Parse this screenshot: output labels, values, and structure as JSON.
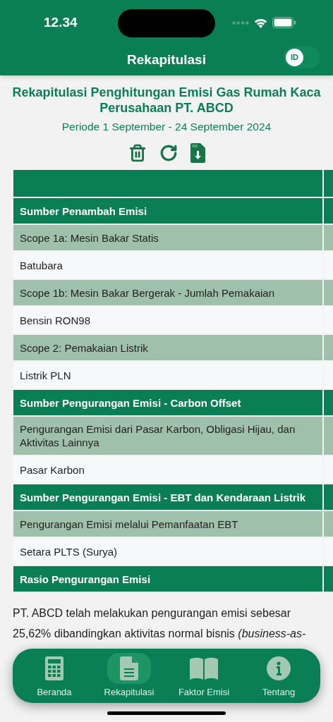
{
  "status_bar": {
    "time": "12.34"
  },
  "header": {
    "title": "Rekapitulasi",
    "language_toggle": {
      "label": "ID"
    }
  },
  "report": {
    "title": "Rekapitulasi Penghitungan Emisi Gas Rumah Kaca Perusahaan PT. ABCD",
    "period": "Periode 1 September - 24 September 2024"
  },
  "table": {
    "rows": [
      {
        "kind": "header",
        "label": ""
      },
      {
        "kind": "section",
        "label": "Sumber Penambah Emisi"
      },
      {
        "kind": "group",
        "label": "Scope 1a: Mesin Bakar Statis"
      },
      {
        "kind": "item",
        "label": "Batubara"
      },
      {
        "kind": "group",
        "label": "Scope 1b: Mesin Bakar Bergerak - Jumlah Pemakaian"
      },
      {
        "kind": "item",
        "label": "Bensin RON98"
      },
      {
        "kind": "group",
        "label": "Scope 2: Pemakaian Listrik"
      },
      {
        "kind": "item",
        "label": "Listrik PLN"
      },
      {
        "kind": "section",
        "label": "Sumber Pengurangan Emisi - Carbon Offset"
      },
      {
        "kind": "group",
        "label": "Pengurangan Emisi dari Pasar Karbon, Obligasi Hijau, dan Aktivitas Lainnya"
      },
      {
        "kind": "item",
        "label": "Pasar Karbon"
      },
      {
        "kind": "section",
        "label": "Sumber Pengurangan Emisi - EBT dan Kendaraan Listrik"
      },
      {
        "kind": "group",
        "label": "Pengurangan Emisi melalui Pemanfaatan EBT"
      },
      {
        "kind": "item",
        "label": "Setara PLTS (Surya)"
      },
      {
        "kind": "section",
        "label": "Rasio Pengurangan Emisi"
      }
    ]
  },
  "summary": "PT. ABCD telah melakukan pengurangan emisi sebesar 25,62% dibandingkan aktivitas normal bisnis *(business-as-*",
  "tab_bar": [
    {
      "label": "Beranda",
      "selected": false
    },
    {
      "label": "Rekapitulasi",
      "selected": true
    },
    {
      "label": "Faktor Emisi",
      "selected": false
    },
    {
      "label": "Tentang",
      "selected": false
    }
  ]
}
